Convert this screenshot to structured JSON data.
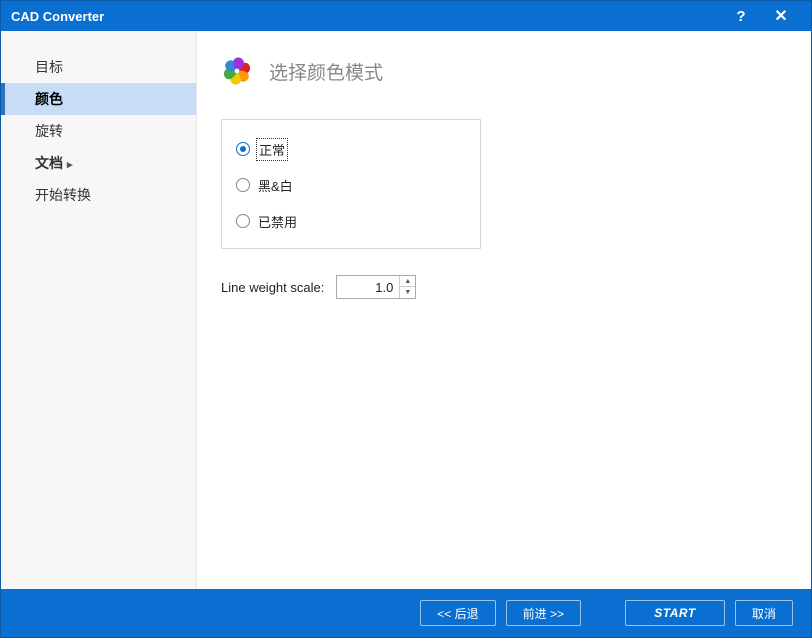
{
  "window": {
    "title": "CAD Converter",
    "help": "?",
    "close": "✕"
  },
  "sidebar": {
    "items": [
      {
        "label": "目标",
        "active": false,
        "bold": false,
        "has_chevron": false
      },
      {
        "label": "颜色",
        "active": true,
        "bold": true,
        "has_chevron": false
      },
      {
        "label": "旋转",
        "active": false,
        "bold": false,
        "has_chevron": false
      },
      {
        "label": "文档",
        "active": false,
        "bold": true,
        "has_chevron": true
      },
      {
        "label": "开始转换",
        "active": false,
        "bold": false,
        "has_chevron": false
      }
    ]
  },
  "heading": {
    "title": "选择颜色模式"
  },
  "radios": {
    "options": [
      {
        "label": "正常",
        "checked": true,
        "focused": true
      },
      {
        "label": "黑&白",
        "checked": false
      },
      {
        "label": "已禁用",
        "checked": false
      }
    ]
  },
  "line_weight": {
    "label": "Line weight scale:",
    "value": "1.0"
  },
  "footer": {
    "back": "<<  后退",
    "next": "前进  >>",
    "start": "START",
    "cancel": "取消"
  }
}
